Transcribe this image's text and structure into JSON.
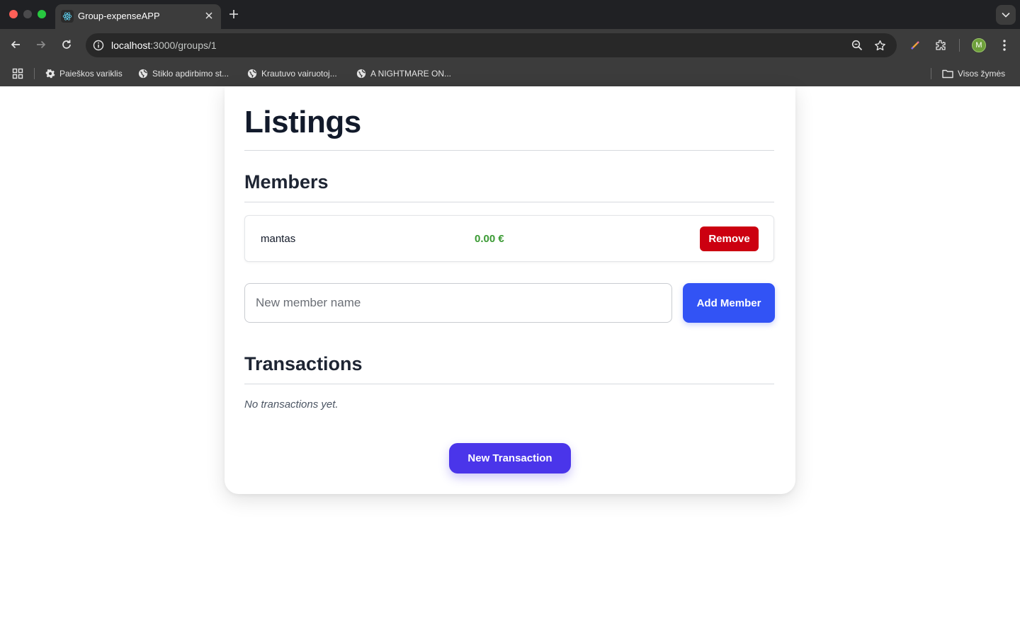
{
  "browser": {
    "tab_title": "Group-expenseAPP",
    "url_host": "localhost",
    "url_path": ":3000/groups/1",
    "profile_initial": "M",
    "bookmarks": [
      {
        "label": "Paieškos variklis",
        "icon": "gear-icon"
      },
      {
        "label": "Stiklo apdirbimo st...",
        "icon": "globe-icon"
      },
      {
        "label": "Krautuvo vairuotoj...",
        "icon": "globe-icon"
      },
      {
        "label": "A NIGHTMARE ON...",
        "icon": "globe-icon"
      }
    ],
    "all_bookmarks_label": "Visos žymės"
  },
  "page": {
    "title": "Listings",
    "members": {
      "heading": "Members",
      "list": [
        {
          "name": "mantas",
          "balance": "0.00 €",
          "remove_label": "Remove"
        }
      ],
      "input_placeholder": "New member name",
      "input_value": "",
      "add_label": "Add Member"
    },
    "transactions": {
      "heading": "Transactions",
      "empty_text": "No transactions yet.",
      "new_label": "New Transaction"
    }
  },
  "colors": {
    "remove_button": "#cc0010",
    "add_button": "#3253f5",
    "new_transaction_button": "#4a35ea",
    "balance_positive": "#3a9a33"
  }
}
